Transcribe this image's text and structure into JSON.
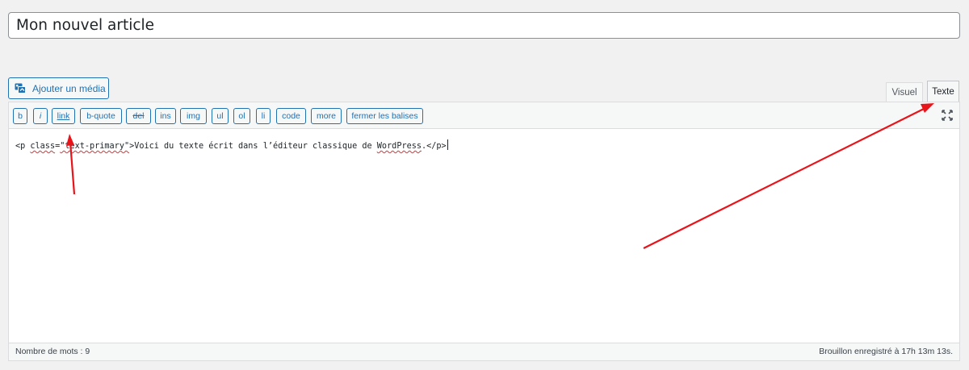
{
  "post": {
    "title": "Mon nouvel article"
  },
  "media": {
    "add_label": "Ajouter un média"
  },
  "tabs": [
    {
      "label": "Visuel"
    },
    {
      "label": "Texte"
    }
  ],
  "quicktags": [
    {
      "label": "b"
    },
    {
      "label": "i"
    },
    {
      "label": "link"
    },
    {
      "label": "b-quote"
    },
    {
      "label": "del"
    },
    {
      "label": "ins"
    },
    {
      "label": "img"
    },
    {
      "label": "ul"
    },
    {
      "label": "ol"
    },
    {
      "label": "li"
    },
    {
      "label": "code"
    },
    {
      "label": "more"
    },
    {
      "label": "fermer les balises"
    }
  ],
  "editor": {
    "open_tag_start": "<p ",
    "attr_name": "class",
    "equals": "=",
    "attr_value": "\"text-primary\"",
    "tag_close": ">",
    "body_before": "Voici du texte écrit dans l’éditeur classique de ",
    "body_word": "WordPress",
    "body_after": ".",
    "close_tag": "</p>"
  },
  "status": {
    "word_count": "Nombre de mots : 9",
    "draft_saved": "Brouillon enregistré à 17h 13m 13s."
  },
  "colors": {
    "accent": "#2271b1",
    "annotation_arrow": "#e8141a",
    "spellcheck": "#d63638"
  },
  "icons": {
    "media": "media-icon",
    "fullscreen": "fullscreen-icon"
  }
}
